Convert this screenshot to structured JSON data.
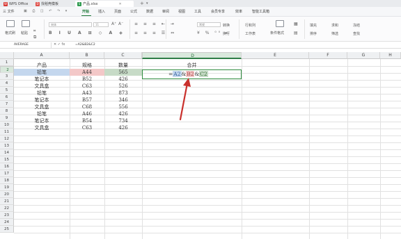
{
  "tabs": [
    {
      "label": "WPS Office",
      "icon": "wps-logo-icon",
      "color": "#d93a35"
    },
    {
      "label": "找稻壳模板",
      "icon": "docer-icon",
      "color": "#e0504a"
    },
    {
      "label": "产品.xlsx",
      "icon": "sheet-file-icon",
      "color": "#2e9a4f",
      "active": true
    }
  ],
  "menubar": {
    "file": "三 文件",
    "items": [
      "开始",
      "插入",
      "页面",
      "公式",
      "数据",
      "审阅",
      "视图",
      "工具",
      "会员专享",
      "效率",
      "智能工具箱"
    ],
    "active": "开始"
  },
  "ribbon": {
    "format_painter": "格式刷",
    "paste": "粘贴",
    "font_name": "宋体",
    "font_size": "11",
    "number_format": "常规",
    "convert": "转换",
    "wrap": "换行",
    "rows_cols": "行和列",
    "worksheet": "工作表",
    "cond_format": "条件格式",
    "fill": "填充",
    "sort": "排序",
    "sum": "求和",
    "filter": "筛选",
    "freeze": "冻结",
    "find": "查找"
  },
  "formula_bar": {
    "name_box": "AVERAGE",
    "icons": "✕ ✓ fx",
    "content": "=A2&B2&C2"
  },
  "columns": [
    "A",
    "B",
    "C",
    "D",
    "E",
    "F",
    "G",
    "H"
  ],
  "rows": [
    "1",
    "2",
    "3",
    "4",
    "5",
    "6",
    "7",
    "8",
    "9",
    "10",
    "11",
    "12",
    "13",
    "14",
    "15",
    "16",
    "17",
    "18",
    "19",
    "20",
    "21",
    "22",
    "23",
    "24",
    "25"
  ],
  "sheet": {
    "header": [
      "产品",
      "规格",
      "数量",
      "合并"
    ],
    "data": [
      [
        "铅笔",
        "A44",
        "565"
      ],
      [
        "笔记本",
        "B52",
        "426"
      ],
      [
        "文具盒",
        "C63",
        "526"
      ],
      [
        "铅笔",
        "A43",
        "873"
      ],
      [
        "笔记本",
        "B57",
        "346"
      ],
      [
        "文具盒",
        "C68",
        "556"
      ],
      [
        "铅笔",
        "A46",
        "426"
      ],
      [
        "笔记本",
        "B54",
        "734"
      ],
      [
        "文具盒",
        "C63",
        "426"
      ]
    ]
  },
  "d2_formula": {
    "eq": "=",
    "ref1": "A2",
    "amp1": "&",
    "ref2": "B2",
    "amp2": "&",
    "ref3": "C2"
  },
  "colors": {
    "accent": "#1f7a3a",
    "ref_a": "#c4d7ee",
    "ref_b": "#f3c8c8",
    "ref_c": "#c7dbc7",
    "arrow": "#c9302c"
  }
}
